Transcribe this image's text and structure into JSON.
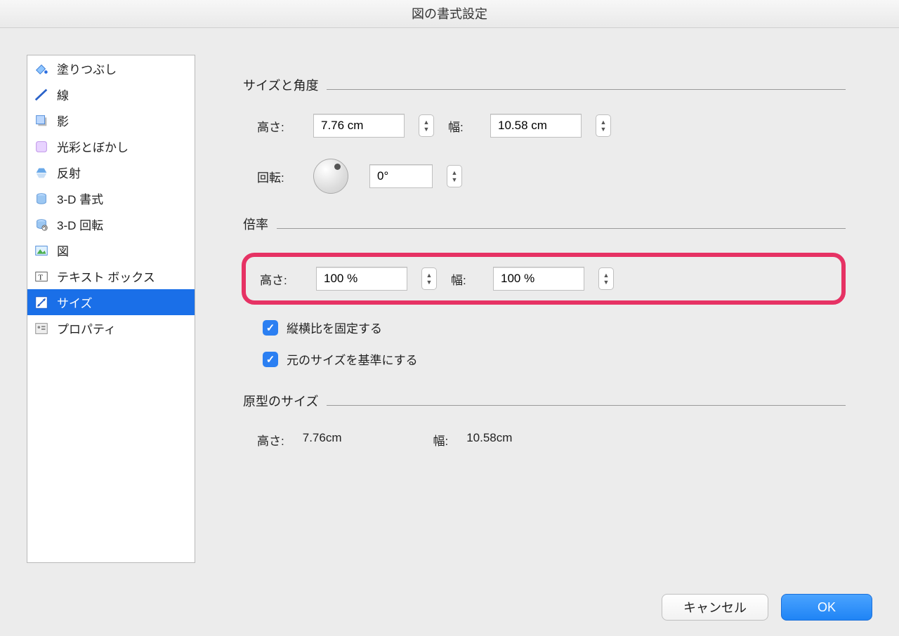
{
  "window": {
    "title": "図の書式設定"
  },
  "sidebar": {
    "items": [
      {
        "label": "塗りつぶし"
      },
      {
        "label": "線"
      },
      {
        "label": "影"
      },
      {
        "label": "光彩とぼかし"
      },
      {
        "label": "反射"
      },
      {
        "label": "3-D 書式"
      },
      {
        "label": "3-D 回転"
      },
      {
        "label": "図"
      },
      {
        "label": "テキスト ボックス"
      },
      {
        "label": "サイズ"
      },
      {
        "label": "プロパティ"
      }
    ]
  },
  "sections": {
    "sizeAngle": {
      "title": "サイズと角度"
    },
    "scale": {
      "title": "倍率"
    },
    "original": {
      "title": "原型のサイズ"
    }
  },
  "fields": {
    "heightLabel": "高さ:",
    "widthLabel": "幅:",
    "rotationLabel": "回転:",
    "heightValue": "7.76 cm",
    "widthValue": "10.58 cm",
    "rotationValue": "0°",
    "scaleHeightValue": "100 %",
    "scaleWidthValue": "100 %",
    "origHeightValue": "7.76cm",
    "origWidthValue": "10.58cm"
  },
  "checks": {
    "lockAspect": "縦横比を固定する",
    "relOriginal": "元のサイズを基準にする"
  },
  "buttons": {
    "cancel": "キャンセル",
    "ok": "OK"
  }
}
